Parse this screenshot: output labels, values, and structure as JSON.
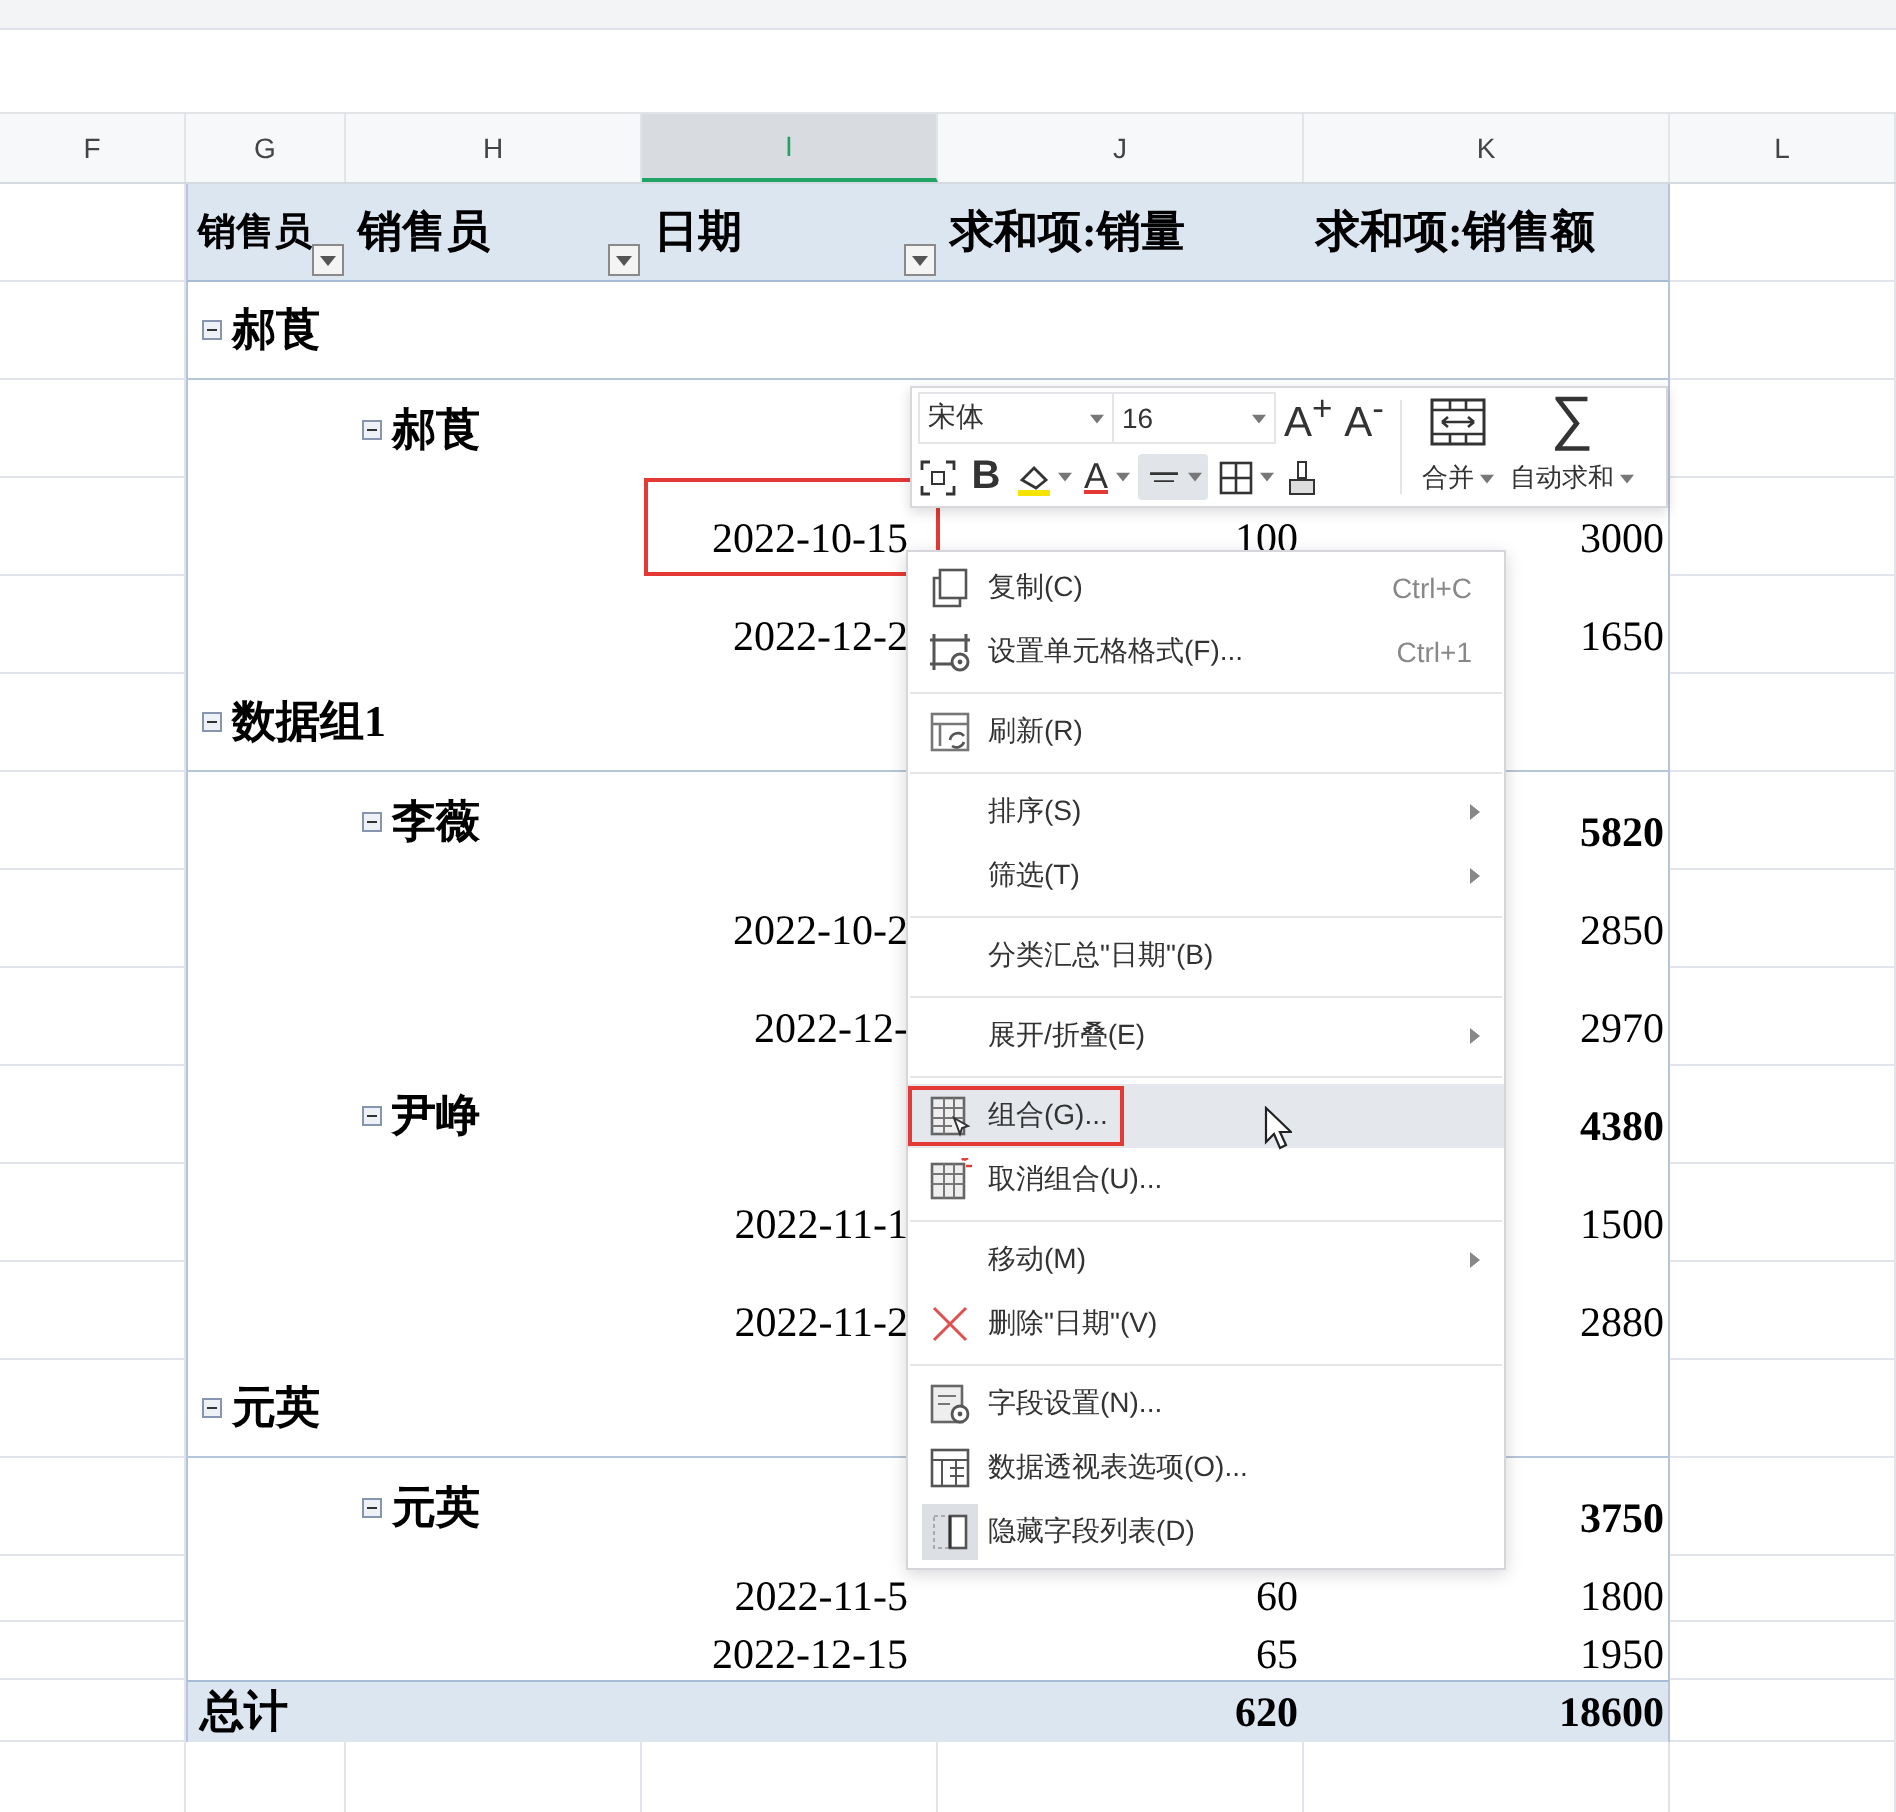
{
  "sheet": {
    "columns": [
      {
        "letter": "F",
        "selected": false
      },
      {
        "letter": "G",
        "selected": false
      },
      {
        "letter": "H",
        "selected": false
      },
      {
        "letter": "I",
        "selected": true
      },
      {
        "letter": "J",
        "selected": false
      },
      {
        "letter": "K",
        "selected": false
      },
      {
        "letter": "L",
        "selected": false
      }
    ]
  },
  "pivot": {
    "headers": [
      {
        "label": "销售员",
        "filter": true
      },
      {
        "label": "销售员",
        "filter": true
      },
      {
        "label": "日期",
        "filter": true
      },
      {
        "label": "求和项:销量",
        "filter": false
      },
      {
        "label": "求和项:销售额",
        "filter": false
      }
    ],
    "groups": [
      {
        "label": "郝莨",
        "expanded": true,
        "children": [
          {
            "label": "郝莨",
            "expanded": true,
            "children": [
              {
                "date": "2022-10-15",
                "qty": "100",
                "sales": "3000",
                "highlighted": true
              },
              {
                "date": "2022-12-2",
                "sales": "1650",
                "highlighted": false
              }
            ]
          }
        ]
      },
      {
        "label": "数据组1",
        "expanded": true,
        "children": [
          {
            "label": "李薇",
            "expanded": true,
            "sales": "5820",
            "children": [
              {
                "date": "2022-10-2",
                "sales": "2850",
                "highlighted": false
              },
              {
                "date": "2022-12-",
                "sales": "2970",
                "highlighted": false
              }
            ]
          },
          {
            "label": "尹峥",
            "expanded": true,
            "sales": "4380",
            "children": [
              {
                "date": "2022-11-1",
                "sales": "1500",
                "highlighted": false
              },
              {
                "date": "2022-11-2",
                "sales": "2880",
                "highlighted": false
              }
            ]
          }
        ]
      },
      {
        "label": "元英",
        "expanded": true,
        "children": [
          {
            "label": "元英",
            "expanded": true,
            "sales": "3750",
            "children": [
              {
                "date": "2022-11-5",
                "qty": "60",
                "sales": "1800",
                "highlighted": false
              },
              {
                "date": "2022-12-15",
                "qty": "65",
                "sales": "1950",
                "highlighted": false
              }
            ]
          }
        ]
      }
    ],
    "total": {
      "label": "总计",
      "qty": "620",
      "sales": "18600"
    }
  },
  "toolbar": {
    "font": "宋体",
    "size": "16",
    "grow": "A$^{+}$",
    "shrink": "A$^{-}$",
    "bold": "B",
    "font_color": "A",
    "align_active": true,
    "merge": "合并",
    "sum_symbol": "∑",
    "autosum": "自动求和"
  },
  "menu": {
    "sections": [
      {
        "items": [
          {
            "label": "复制(C)",
            "shortcut": "Ctrl+C",
            "submenu": false,
            "hovered": false,
            "highlighted": false,
            "checked": false
          },
          {
            "label": "设置单元格格式(F)...",
            "shortcut": "Ctrl+1",
            "submenu": false,
            "hovered": false,
            "highlighted": false,
            "checked": false
          }
        ]
      },
      {
        "items": [
          {
            "label": "刷新(R)",
            "submenu": false,
            "hovered": false,
            "highlighted": false,
            "checked": false
          }
        ]
      },
      {
        "items": [
          {
            "label": "排序(S)",
            "submenu": true,
            "hovered": false,
            "highlighted": false,
            "checked": false
          },
          {
            "label": "筛选(T)",
            "submenu": true,
            "hovered": false,
            "highlighted": false,
            "checked": false
          }
        ]
      },
      {
        "items": [
          {
            "label": "分类汇总\"日期\"(B)",
            "submenu": false,
            "hovered": false,
            "highlighted": false,
            "checked": false
          }
        ]
      },
      {
        "items": [
          {
            "label": "展开/折叠(E)",
            "submenu": true,
            "hovered": false,
            "highlighted": false,
            "checked": false
          }
        ]
      },
      {
        "items": [
          {
            "label": "组合(G)...",
            "submenu": false,
            "hovered": true,
            "highlighted": true,
            "checked": false
          },
          {
            "label": "取消组合(U)...",
            "submenu": false,
            "hovered": false,
            "highlighted": false,
            "checked": false
          }
        ]
      },
      {
        "items": [
          {
            "label": "移动(M)",
            "submenu": true,
            "hovered": false,
            "highlighted": false,
            "checked": false
          },
          {
            "label": "删除\"日期\"(V)",
            "submenu": false,
            "hovered": false,
            "highlighted": false,
            "checked": false
          }
        ]
      },
      {
        "items": [
          {
            "label": "字段设置(N)...",
            "submenu": false,
            "hovered": false,
            "highlighted": false,
            "checked": false
          },
          {
            "label": "数据透视表选项(O)...",
            "submenu": false,
            "hovered": false,
            "highlighted": false,
            "checked": false
          },
          {
            "label": "隐藏字段列表(D)",
            "submenu": false,
            "hovered": false,
            "highlighted": false,
            "checked": true
          }
        ]
      }
    ]
  }
}
